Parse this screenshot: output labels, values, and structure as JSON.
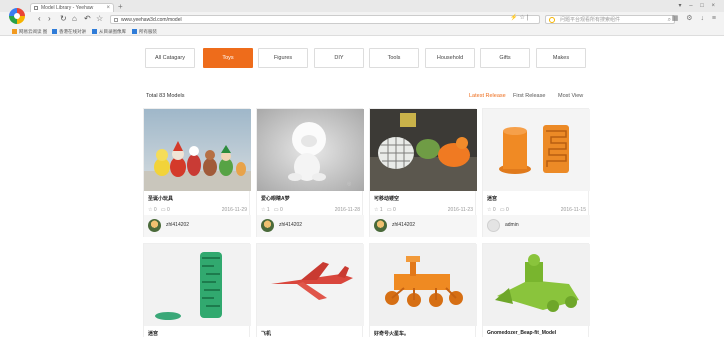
{
  "browser": {
    "tab_title": "Model Library - Yeehaw",
    "address": "www.yeehaw3d.com/model",
    "search_placeholder": "问题平台观看所有搜索组件",
    "bookmarks": [
      {
        "label": "网易云阅读 图"
      },
      {
        "label": "香港在线对讲"
      },
      {
        "label": "从目录图像库"
      },
      {
        "label": "所有服装"
      }
    ]
  },
  "categories": [
    {
      "label": "All Catagary",
      "active": false
    },
    {
      "label": "Toys",
      "active": true
    },
    {
      "label": "Figures",
      "active": false
    },
    {
      "label": "DIY",
      "active": false
    },
    {
      "label": "Tools",
      "active": false
    },
    {
      "label": "Household",
      "active": false
    },
    {
      "label": "Gifts",
      "active": false
    },
    {
      "label": "Makes",
      "active": false
    }
  ],
  "total_label": "Total 83 Models",
  "sort": {
    "latest": "Latest Release",
    "first": "First Release",
    "most": "Most View"
  },
  "colors": {
    "accent": "#ee6c1b"
  },
  "models": [
    {
      "title": "圣诞小玩具",
      "likes": "0",
      "comments": "0",
      "date": "2016-11-29",
      "user": "zhl414202"
    },
    {
      "title": "爱心眼睛A梦",
      "likes": "1",
      "comments": "0",
      "date": "2016-11-28",
      "user": "zhl414202"
    },
    {
      "title": "可移动镂空",
      "likes": "1",
      "comments": "0",
      "date": "2016-11-23",
      "user": "zhl414202"
    },
    {
      "title": "迷宫",
      "likes": "0",
      "comments": "0",
      "date": "2016-11-15",
      "user": "admin"
    },
    {
      "title": "迷宫"
    },
    {
      "title": "飞机"
    },
    {
      "title": "好奇号火星车。"
    },
    {
      "title": "Gnomedozer_Beap-fit_Model"
    }
  ]
}
